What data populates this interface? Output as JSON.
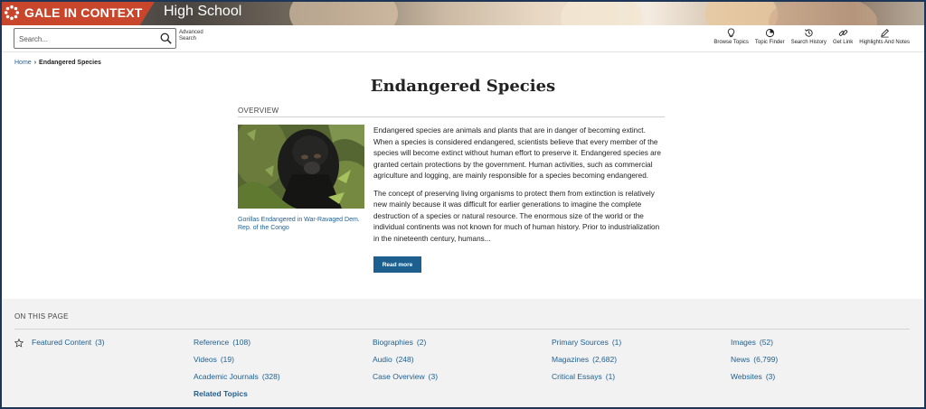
{
  "brand": {
    "name": "GALE IN CONTEXT",
    "product": "High School",
    "color": "#c8462c"
  },
  "search": {
    "placeholder": "Search...",
    "advanced_label": "Advanced Search"
  },
  "tools": [
    {
      "label": "Browse Topics",
      "icon": "lightbulb-icon"
    },
    {
      "label": "Topic Finder",
      "icon": "topic-finder-icon"
    },
    {
      "label": "Search History",
      "icon": "history-icon"
    },
    {
      "label": "Get Link",
      "icon": "link-icon"
    },
    {
      "label": "Highlights And Notes",
      "icon": "pencil-icon"
    }
  ],
  "breadcrumb": {
    "home": "Home",
    "current": "Endangered Species"
  },
  "page": {
    "title": "Endangered Species",
    "overview_label": "OVERVIEW",
    "image_caption": "Gorillas Endangered in War-Ravaged Dem. Rep. of the Congo",
    "paragraphs": [
      "Endangered species are animals and plants that are in danger of becoming extinct. When a species is considered endangered, scientists believe that every member of the species will become extinct without human effort to preserve it. Endangered species are granted certain protections by the government. Human activities, such as commercial agriculture and logging, are mainly responsible for a species becoming endangered.",
      "The concept of preserving living organisms to protect them from extinction is relatively new mainly because it was difficult for earlier generations to imagine the complete destruction of a species or natural resource. The enormous size of the world or the individual continents was not known for much of human history. Prior to industrialization in the nineteenth century, humans..."
    ],
    "read_more": "Read more"
  },
  "on_this_page": {
    "label": "ON THIS PAGE",
    "items": [
      {
        "label": "Featured Content",
        "count": "(3)"
      },
      {
        "label": "Reference",
        "count": "(108)"
      },
      {
        "label": "Biographies",
        "count": "(2)"
      },
      {
        "label": "Primary Sources",
        "count": "(1)"
      },
      {
        "label": "Images",
        "count": "(52)"
      },
      {
        "label": "Videos",
        "count": "(19)"
      },
      {
        "label": "Audio",
        "count": "(248)"
      },
      {
        "label": "Magazines",
        "count": "(2,682)"
      },
      {
        "label": "News",
        "count": "(6,799)"
      },
      {
        "label": "Academic Journals",
        "count": "(328)"
      },
      {
        "label": "Case Overview",
        "count": "(3)"
      },
      {
        "label": "Critical Essays",
        "count": "(1)"
      },
      {
        "label": "Websites",
        "count": "(3)"
      },
      {
        "label": "Related Topics"
      }
    ]
  }
}
